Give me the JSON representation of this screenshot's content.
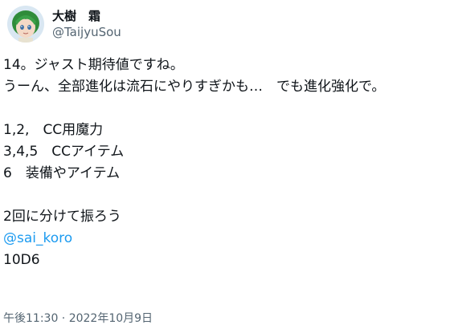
{
  "author": {
    "display_name": "大樹　霜",
    "handle": "@TaijyuSou",
    "avatar_icon": "anime-character-avatar-icon",
    "avatar_colors": {
      "hair": "#2f8c3a",
      "skin": "#f4d9c6",
      "background": "#d9e7f2"
    }
  },
  "tweet": {
    "lines": [
      "14。ジャスト期待値ですね。",
      "うーん、全部進化は流石にやりすぎかも…　でも進化強化で。",
      "1,2,　CC用魔力",
      "3,4,5　CCアイテム",
      "6　装備やアイテム",
      "2回に分けて振ろう"
    ],
    "mention": "@sai_koro",
    "dice": "10D6",
    "mention_color": "#1d9bf0"
  },
  "meta": {
    "timestamp": "午後11:30 · 2022年10月9日"
  }
}
